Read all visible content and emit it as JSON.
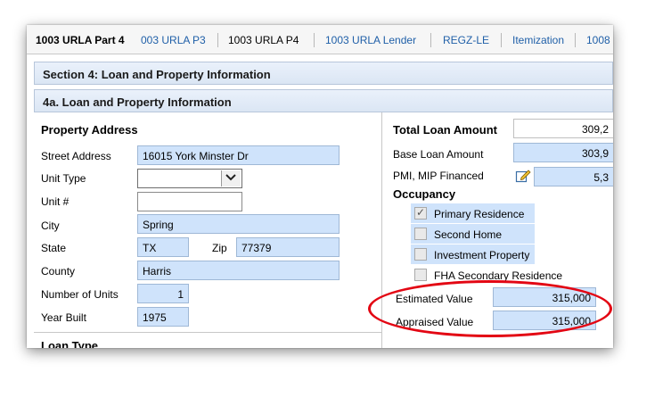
{
  "tabs": [
    {
      "label": "1003 URLA Part 4"
    },
    {
      "label": "003 URLA P3"
    },
    {
      "label": "1003 URLA P4"
    },
    {
      "label": "1003 URLA Lender"
    },
    {
      "label": "REGZ-LE"
    },
    {
      "label": "Itemization"
    },
    {
      "label": "1008"
    }
  ],
  "section_title": "Section 4: Loan and Property Information",
  "subsection_title": "4a. Loan and Property Information",
  "property": {
    "heading": "Property Address",
    "street_label": "Street Address",
    "street_value": "16015 York Minster Dr",
    "unit_type_label": "Unit Type",
    "unit_type_value": "",
    "unit_no_label": "Unit #",
    "unit_no_value": "",
    "city_label": "City",
    "city_value": "Spring",
    "state_label": "State",
    "state_value": "TX",
    "zip_label": "Zip",
    "zip_value": "77379",
    "county_label": "County",
    "county_value": "Harris",
    "units_label": "Number of Units",
    "units_value": "1",
    "year_label": "Year Built",
    "year_value": "1975"
  },
  "loan": {
    "total_label": "Total Loan Amount",
    "total_value": "309,2",
    "base_label": "Base Loan Amount",
    "base_value": "303,9",
    "pmi_label": "PMI, MIP Financed",
    "pmi_value": "5,3",
    "occupancy_label": "Occupancy",
    "occupancy_options": [
      {
        "label": "Primary Residence",
        "checked": true
      },
      {
        "label": "Second Home",
        "checked": false
      },
      {
        "label": "Investment Property",
        "checked": false
      },
      {
        "label": "FHA Secondary Residence",
        "checked": false
      }
    ],
    "estimated_label": "Estimated Value",
    "estimated_value": "315,000",
    "appraised_label": "Appraised Value",
    "appraised_value": "315,000"
  },
  "loan_type_heading": "Loan Type",
  "colors": {
    "field_fill": "#cfe3fb",
    "link": "#1f5fa8",
    "highlight": "#e30613"
  }
}
